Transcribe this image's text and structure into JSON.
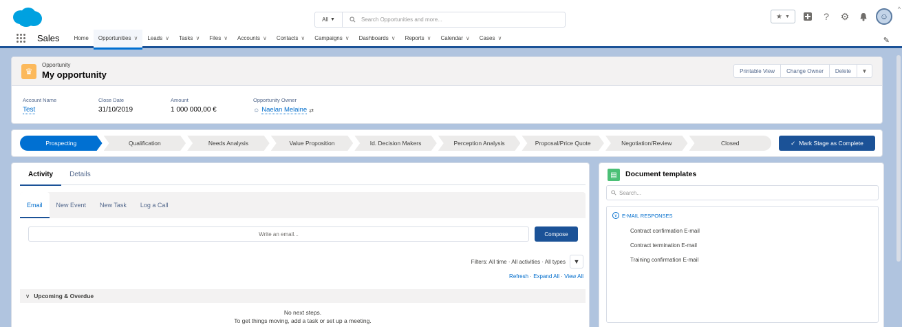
{
  "header": {
    "search_scope": "All",
    "search_placeholder": "Search Opportunities and more..."
  },
  "nav": {
    "app_name": "Sales",
    "items": [
      {
        "label": "Home",
        "chevron": false,
        "active": false
      },
      {
        "label": "Opportunities",
        "chevron": true,
        "active": true
      },
      {
        "label": "Leads",
        "chevron": true,
        "active": false
      },
      {
        "label": "Tasks",
        "chevron": true,
        "active": false
      },
      {
        "label": "Files",
        "chevron": true,
        "active": false
      },
      {
        "label": "Accounts",
        "chevron": true,
        "active": false
      },
      {
        "label": "Contacts",
        "chevron": true,
        "active": false
      },
      {
        "label": "Campaigns",
        "chevron": true,
        "active": false
      },
      {
        "label": "Dashboards",
        "chevron": true,
        "active": false
      },
      {
        "label": "Reports",
        "chevron": true,
        "active": false
      },
      {
        "label": "Calendar",
        "chevron": true,
        "active": false
      },
      {
        "label": "Cases",
        "chevron": true,
        "active": false
      }
    ]
  },
  "record": {
    "object_type": "Opportunity",
    "name": "My opportunity",
    "actions": [
      "Printable View",
      "Change Owner",
      "Delete"
    ],
    "fields": {
      "account_label": "Account Name",
      "account_value": "Test",
      "close_label": "Close Date",
      "close_value": "31/10/2019",
      "amount_label": "Amount",
      "amount_value": "1 000 000,00 €",
      "owner_label": "Opportunity Owner",
      "owner_value": "Naelan Melaine"
    }
  },
  "path": {
    "stages": [
      "Prospecting",
      "Qualification",
      "Needs Analysis",
      "Value Proposition",
      "Id. Decision Makers",
      "Perception Analysis",
      "Proposal/Price Quote",
      "Negotiation/Review",
      "Closed"
    ],
    "current": 0,
    "mark_button": "Mark Stage as Complete"
  },
  "activity": {
    "tabs": [
      "Activity",
      "Details"
    ],
    "sub_tabs": [
      "Email",
      "New Event",
      "New Task",
      "Log a Call"
    ],
    "email_placeholder": "Write an email...",
    "compose": "Compose",
    "filters": "Filters: All time · All activities · All types",
    "refresh": "Refresh",
    "expand_all": "Expand All",
    "view_all": "View All",
    "upcoming": "Upcoming & Overdue",
    "no_steps_1": "No next steps.",
    "no_steps_2": "To get things moving, add a task or set up a meeting."
  },
  "docs": {
    "title": "Document templates",
    "search_placeholder": "Search...",
    "group": "E-MAIL RESPONSES",
    "items": [
      "Contract confirmation E-mail",
      "Contract termination E-mail",
      "Training confirmation E-mail"
    ]
  },
  "colors": {
    "brand": "#1b5297",
    "active_stage": "#0070d2",
    "link": "#006dcc",
    "object_icon": "#fcb95b"
  }
}
